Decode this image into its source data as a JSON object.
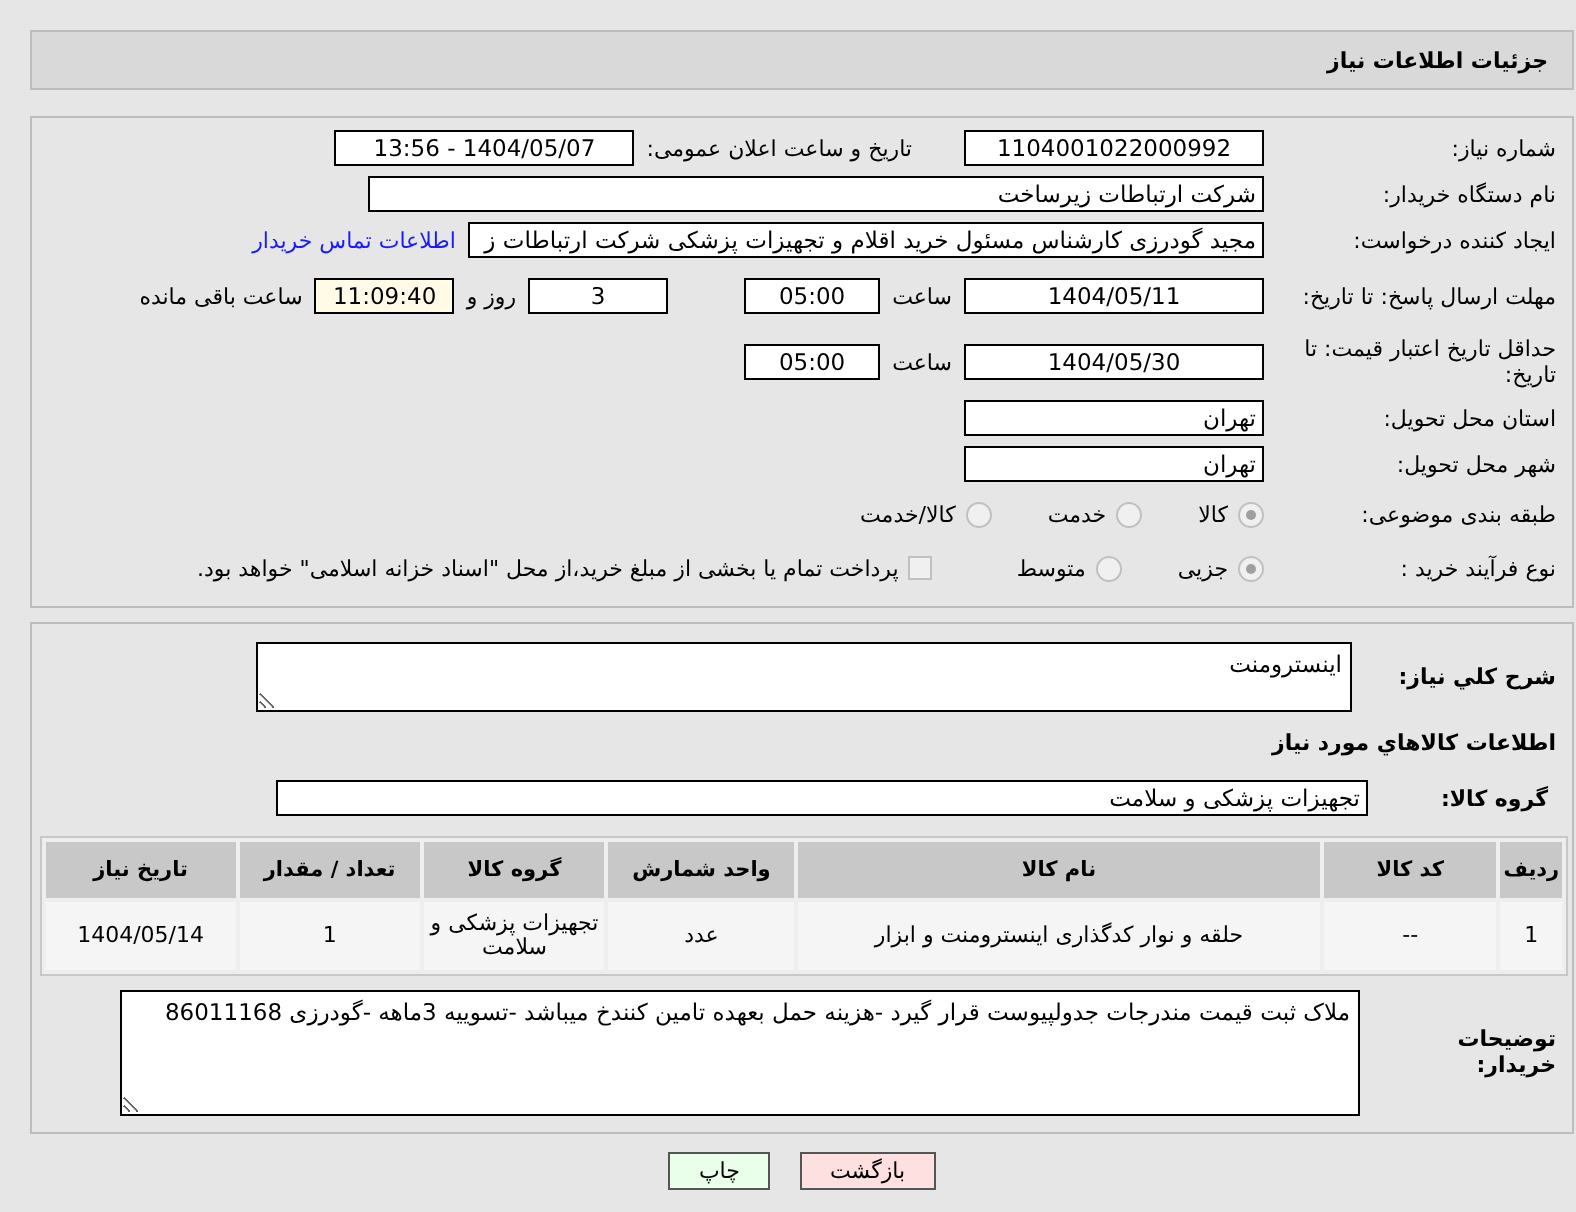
{
  "header": {
    "title": "جزئیات اطلاعات نیاز"
  },
  "details": {
    "need_number": {
      "label": "شماره نیاز:",
      "value": "1104001022000992"
    },
    "announce": {
      "label": "تاریخ و ساعت اعلان عمومی:",
      "value": "1404/05/07 - 13:56"
    },
    "buyer": {
      "label": "نام دستگاه خریدار:",
      "value": "شرکت ارتباطات زیرساخت"
    },
    "creator": {
      "label": "ایجاد کننده درخواست:",
      "value": "مجید گودرزی کارشناس مسئول خرید اقلام و تجهیزات پزشکی شرکت ارتباطات ز",
      "link": "اطلاعات تماس خریدار"
    },
    "deadline": {
      "label": "مهلت ارسال پاسخ: تا تاریخ:",
      "date": "1404/05/11",
      "time_label": "ساعت",
      "time": "05:00",
      "days": "3",
      "days_label": "روز و",
      "remaining": "11:09:40",
      "remaining_label": "ساعت باقی مانده"
    },
    "validity": {
      "label": "حداقل تاریخ اعتبار قیمت: تا تاریخ:",
      "date": "1404/05/30",
      "time_label": "ساعت",
      "time": "05:00"
    },
    "province": {
      "label": "استان محل تحویل:",
      "value": "تهران"
    },
    "city": {
      "label": "شهر محل تحویل:",
      "value": "تهران"
    },
    "category": {
      "label": "طبقه بندی موضوعی:",
      "options": [
        {
          "label": "کالا",
          "selected": true
        },
        {
          "label": "خدمت",
          "selected": false
        },
        {
          "label": "کالا/خدمت",
          "selected": false
        }
      ]
    },
    "process": {
      "label": "نوع فرآیند خرید :",
      "options": [
        {
          "label": "جزیی",
          "selected": true
        },
        {
          "label": "متوسط",
          "selected": false
        }
      ],
      "payment": {
        "checked": false,
        "label": "پرداخت تمام یا بخشی از مبلغ خرید،از محل \"اسناد خزانه اسلامی\" خواهد بود."
      }
    }
  },
  "goods": {
    "summary": {
      "label": "شرح کلي نياز:",
      "value": "اینسترومنت"
    },
    "section_title": "اطلاعات کالاهاي مورد نياز",
    "group": {
      "label": "گروه کالا:",
      "value": "تجهیزات پزشکی و سلامت"
    },
    "table": {
      "columns": [
        "ردیف",
        "کد کالا",
        "نام کالا",
        "واحد شمارش",
        "گروه کالا",
        "تعداد / مقدار",
        "تاریخ نیاز"
      ],
      "rows": [
        [
          "1",
          "--",
          "حلقه و نوار کدگذاری اینسترومنت و ابزار",
          "عدد",
          "تجهیزات پزشکی و سلامت",
          "1",
          "1404/05/14"
        ]
      ]
    },
    "notes": {
      "label": "توضیحات خریدار:",
      "value": "ملاک ثبت قیمت مندرجات جدولپیوست قرار گیرد -هزینه حمل بعهده تامین کنندخ میباشد -تسوییه 3ماهه -گودرزی 86011168"
    }
  },
  "buttons": [
    {
      "kind": "back",
      "label": "بازگشت"
    },
    {
      "kind": "print",
      "label": "چاپ"
    }
  ]
}
